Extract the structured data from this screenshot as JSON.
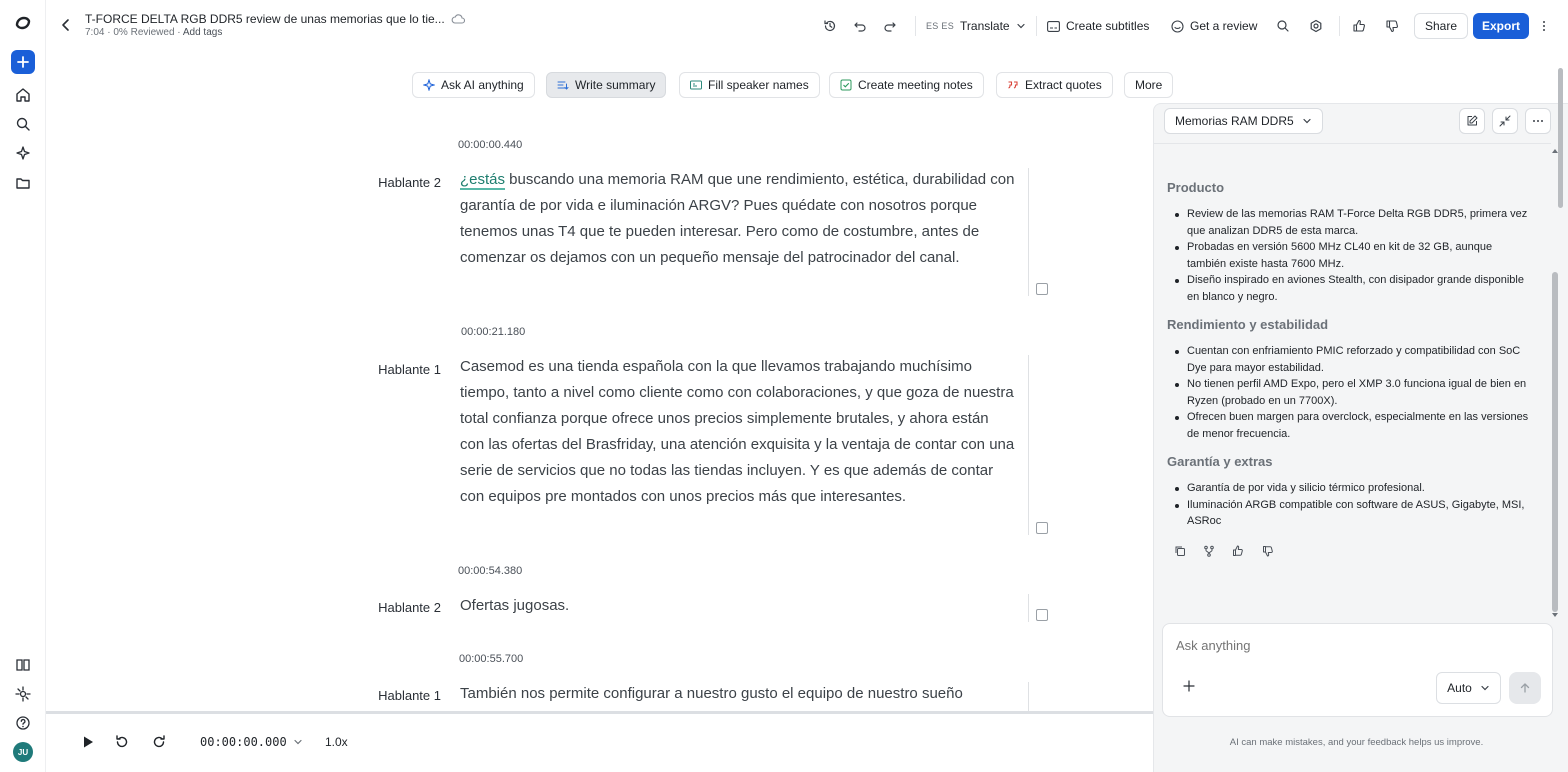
{
  "header": {
    "title": "T-FORCE DELTA RGB DDR5 review de unas memorias que lo tie...",
    "meta_duration": "7:04",
    "meta_reviewed": "0% Reviewed",
    "meta_tags": "Add tags",
    "lang_code": "ES ES",
    "translate_label": "Translate",
    "subtitles_label": "Create subtitles",
    "review_label": "Get a review",
    "share_label": "Share",
    "export_label": "Export"
  },
  "chips": {
    "ask": "Ask AI anything",
    "summary": "Write summary",
    "speakers": "Fill speaker names",
    "notes": "Create meeting notes",
    "quotes": "Extract quotes",
    "more": "More"
  },
  "transcript": [
    {
      "time": "00:00:00.440",
      "speaker": "Hablante 2",
      "highlight": "¿estás",
      "text": " buscando una memoria RAM que une rendimiento, estética, durabilidad con garantía de por vida e iluminación ARGV? Pues quédate con nosotros porque tenemos unas T4 que te pueden interesar. Pero como de costumbre, antes de comenzar os dejamos con un pequeño mensaje del patrocinador del canal."
    },
    {
      "time": "00:00:21.180",
      "speaker": "Hablante 1",
      "text": "Casemod es una tienda española con la que llevamos trabajando muchísimo tiempo, tanto a nivel como cliente como con colaboraciones, y que goza de nuestra total confianza porque ofrece unos precios simplemente brutales, y ahora están con las ofertas del Brasfriday, una atención exquisita y la ventaja de contar con una serie de servicios que no todas las tiendas incluyen. Y es que además de contar con equipos pre montados con unos precios más que interesantes."
    },
    {
      "time": "00:00:54.380",
      "speaker": "Hablante 2",
      "text": "Ofertas jugosas."
    },
    {
      "time": "00:00:55.700",
      "speaker": "Hablante 1",
      "text": "También nos permite configurar a nuestro gusto el equipo de nuestro sueño"
    }
  ],
  "player": {
    "time": "00:00:00.000",
    "speed": "1.0x"
  },
  "panel": {
    "select_label": "Memorias RAM DDR5",
    "sections": [
      {
        "heading": "Producto",
        "items": [
          "Review de las memorias RAM T-Force Delta RGB DDR5, primera vez que analizan DDR5 de esta marca.",
          "Probadas en versión 5600 MHz CL40 en kit de 32 GB, aunque también existe hasta 7600 MHz.",
          "Diseño inspirado en aviones Stealth, con disipador grande disponible en blanco y negro."
        ]
      },
      {
        "heading": "Rendimiento y estabilidad",
        "items": [
          "Cuentan con enfriamiento PMIC reforzado y compatibilidad con SoC Dye para mayor estabilidad.",
          "No tienen perfil AMD Expo, pero el XMP 3.0 funciona igual de bien en Ryzen (probado en un 7700X).",
          "Ofrecen buen margen para overclock, especialmente en las versiones de menor frecuencia."
        ]
      },
      {
        "heading": "Garantía y extras",
        "items": [
          "Garantía de por vida y silicio térmico profesional.",
          "Iluminación ARGB compatible con software de ASUS, Gigabyte, MSI, ASRoc"
        ]
      }
    ],
    "ask_placeholder": "Ask anything",
    "mode": "Auto",
    "disclaimer": "AI can make mistakes, and your feedback helps us improve."
  },
  "user": {
    "initials": "JU"
  },
  "colors": {
    "accent": "#1a5fd8",
    "highlight": "#1e7d6e",
    "avatar": "#1f7a7a"
  }
}
